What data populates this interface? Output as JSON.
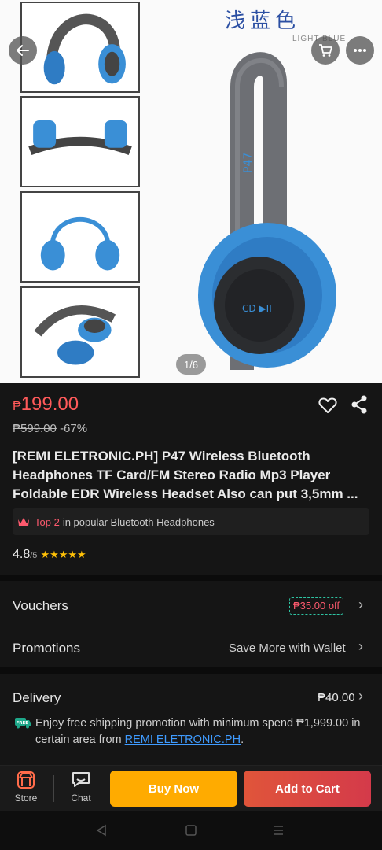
{
  "gallery": {
    "page_indicator": "1/6",
    "overlay_text": "浅蓝色",
    "overlay_subtext": "LIGHT BLUE"
  },
  "product": {
    "currency": "₱",
    "price": "199.00",
    "original_price": "₱599.00",
    "discount": "-67%",
    "title": "[REMI ELETRONIC.PH] P47 Wireless Bluetooth Headphones TF Card/FM Stereo Radio Mp3 Player Foldable EDR Wireless Headset Also can put 3,5mm ...",
    "rank_top": "Top 2",
    "rank_text": "in popular Bluetooth Headphones",
    "rating": "4.8",
    "rating_of": "/5",
    "stars": "★★★★★"
  },
  "vouchers": {
    "label": "Vouchers",
    "tag": "₱35.00 off"
  },
  "promotions": {
    "label": "Promotions",
    "value": "Save More with Wallet"
  },
  "delivery": {
    "label": "Delivery",
    "price": "₱40.00",
    "badge": "FREE",
    "shipping_text": "Enjoy free shipping promotion with minimum spend ₱1,999.00 in certain area from",
    "shop_link": "REMI ELETRONIC.PH",
    "period": "."
  },
  "bottom_bar": {
    "store": "Store",
    "chat": "Chat",
    "buy_now": "Buy Now",
    "add_to_cart": "Add to Cart"
  },
  "colors": {
    "price": "#ff5a5a",
    "buy_now": "#ffab00",
    "add_to_cart": "#d43a4a",
    "link": "#3f9bff",
    "star": "#ffc107"
  }
}
